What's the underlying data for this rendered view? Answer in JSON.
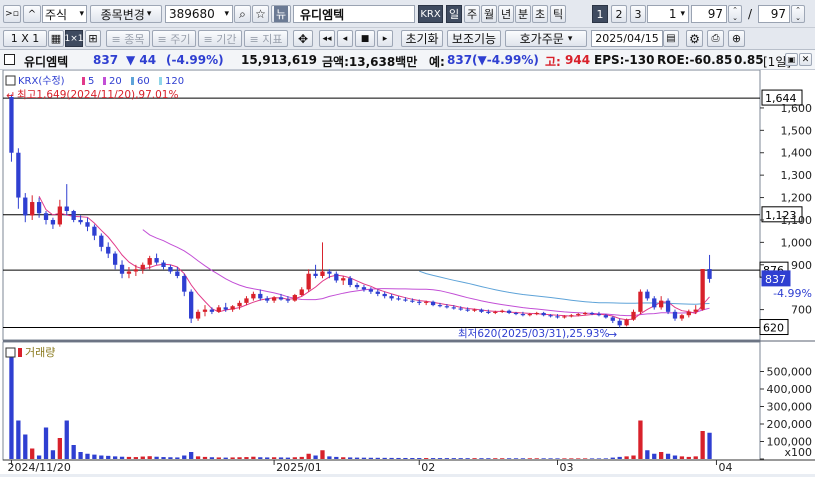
{
  "toolbar1": {
    "market": "주식",
    "change_btn": "종목변경",
    "code": "389680",
    "stock_name": "유디엠텍",
    "exchange": "KRX",
    "periods": [
      "일",
      "주",
      "월",
      "년",
      "분",
      "초",
      "틱"
    ],
    "chart_counts": [
      "1",
      "2",
      "3"
    ],
    "count_value": "1",
    "page_value": "97",
    "slash": "/",
    "page_total": "97"
  },
  "toolbar2": {
    "grid_label": "1 X 1",
    "items_label": "≡ 종목",
    "cycle_label": "≡ 주기",
    "period_label": "≡ 기간",
    "indicator_label": "≡ 지표",
    "reset_label": "초기화",
    "aux_label": "보조기능",
    "order_label": "호가주문",
    "date": "2025/04/15"
  },
  "infobar": {
    "name": "유디엠텍",
    "price": "837",
    "change": "▼ 44",
    "rate": "(-4.99%)",
    "volume": "15,913,619",
    "amount": "금액:13,638백만",
    "expected_label": "예:",
    "expected_value": "837(▼-4.99%)",
    "high_label": "고:",
    "high_value": "944",
    "eps": "EPS:-130",
    "roe": "ROE:-60.85",
    "ratio": "0.85",
    "unit": "[1일]"
  },
  "legend": {
    "price_title": "KRX(수정)",
    "ma": [
      "5",
      "20",
      "60",
      "120"
    ],
    "ma_colors": [
      "#e13a8a",
      "#c24fd6",
      "#5ea3d8",
      "#8fd5e8"
    ],
    "max_note": "최고1,649(2024/11/20),97.01%",
    "min_note": "최저620(2025/03/31),25.93%",
    "volume_title": "거래량"
  },
  "colors": {
    "up": "#d8212b",
    "down": "#2f3fd1",
    "ma5": "#e13a8a",
    "ma20": "#c24fd6",
    "ma60": "#5ea3d8",
    "ma120": "#8fd5e8"
  },
  "chart_data": {
    "type": "candlestick",
    "ylim": [
      600,
      1680
    ],
    "y_ticks": [
      "1,600",
      "1,500",
      "1,400",
      "1,300",
      "1,200",
      "1,100",
      "1,000",
      "900",
      "700"
    ],
    "markers": [
      {
        "label": "1,644",
        "value": 1644,
        "color": "#000000"
      },
      {
        "label": "1,123",
        "value": 1123,
        "color": "#000000"
      },
      {
        "label": "876",
        "value": 876,
        "color": "#000000"
      },
      {
        "label": "837",
        "value": 837,
        "color": "#2f3fd1"
      },
      {
        "label": "620",
        "value": 620,
        "color": "#000000"
      }
    ],
    "current_change": "-4.99%",
    "x_labels": [
      "2024/11/20",
      "2025/01",
      "02",
      "03",
      "04"
    ],
    "x_label_index": [
      0,
      38,
      59,
      79,
      102
    ],
    "volume_ticks": [
      "500,000",
      "400,000",
      "300,000",
      "200,000",
      "100,000",
      "x100"
    ],
    "volume_max": 6000000,
    "candles": [
      [
        1649,
        1660,
        1360,
        1400
      ],
      [
        1400,
        1420,
        1150,
        1200
      ],
      [
        1200,
        1220,
        1090,
        1120
      ],
      [
        1120,
        1210,
        1100,
        1180
      ],
      [
        1180,
        1200,
        1110,
        1130
      ],
      [
        1130,
        1140,
        1080,
        1100
      ],
      [
        1100,
        1110,
        1060,
        1080
      ],
      [
        1080,
        1190,
        1070,
        1160
      ],
      [
        1160,
        1260,
        1120,
        1140
      ],
      [
        1140,
        1145,
        1090,
        1100
      ],
      [
        1100,
        1120,
        1080,
        1090
      ],
      [
        1090,
        1110,
        1050,
        1070
      ],
      [
        1070,
        1080,
        1010,
        1030
      ],
      [
        1030,
        1040,
        960,
        980
      ],
      [
        980,
        1000,
        930,
        950
      ],
      [
        950,
        960,
        880,
        900
      ],
      [
        900,
        920,
        840,
        860
      ],
      [
        860,
        890,
        840,
        870
      ],
      [
        870,
        900,
        850,
        880
      ],
      [
        880,
        910,
        860,
        900
      ],
      [
        900,
        940,
        880,
        930
      ],
      [
        930,
        950,
        900,
        910
      ],
      [
        910,
        920,
        880,
        890
      ],
      [
        890,
        900,
        860,
        870
      ],
      [
        870,
        890,
        840,
        850
      ],
      [
        850,
        860,
        760,
        780
      ],
      [
        780,
        790,
        640,
        660
      ],
      [
        660,
        700,
        650,
        690
      ],
      [
        690,
        720,
        670,
        700
      ],
      [
        700,
        710,
        680,
        690
      ],
      [
        690,
        720,
        685,
        710
      ],
      [
        710,
        730,
        690,
        700
      ],
      [
        700,
        720,
        690,
        715
      ],
      [
        715,
        740,
        700,
        730
      ],
      [
        730,
        760,
        720,
        750
      ],
      [
        750,
        780,
        740,
        770
      ],
      [
        770,
        790,
        740,
        750
      ],
      [
        750,
        760,
        730,
        740
      ],
      [
        740,
        760,
        730,
        755
      ],
      [
        755,
        770,
        740,
        745
      ],
      [
        745,
        760,
        730,
        740
      ],
      [
        740,
        770,
        735,
        765
      ],
      [
        765,
        800,
        760,
        790
      ],
      [
        790,
        880,
        780,
        860
      ],
      [
        860,
        900,
        840,
        850
      ],
      [
        850,
        1000,
        840,
        870
      ],
      [
        870,
        880,
        840,
        860
      ],
      [
        860,
        870,
        820,
        830
      ],
      [
        830,
        850,
        810,
        840
      ],
      [
        840,
        850,
        800,
        810
      ],
      [
        810,
        820,
        790,
        800
      ],
      [
        800,
        810,
        780,
        790
      ],
      [
        790,
        800,
        770,
        780
      ],
      [
        780,
        790,
        760,
        770
      ],
      [
        770,
        780,
        750,
        760
      ],
      [
        760,
        770,
        740,
        750
      ],
      [
        750,
        760,
        740,
        745
      ],
      [
        745,
        755,
        735,
        740
      ],
      [
        740,
        750,
        730,
        735
      ],
      [
        735,
        745,
        720,
        730
      ],
      [
        730,
        740,
        720,
        735
      ],
      [
        735,
        740,
        715,
        720
      ],
      [
        720,
        730,
        710,
        715
      ],
      [
        715,
        725,
        705,
        710
      ],
      [
        710,
        720,
        700,
        705
      ],
      [
        705,
        715,
        695,
        700
      ],
      [
        700,
        710,
        690,
        695
      ],
      [
        695,
        705,
        690,
        700
      ],
      [
        700,
        705,
        685,
        690
      ],
      [
        690,
        700,
        680,
        685
      ],
      [
        685,
        695,
        680,
        690
      ],
      [
        690,
        700,
        685,
        695
      ],
      [
        695,
        700,
        680,
        685
      ],
      [
        685,
        690,
        675,
        680
      ],
      [
        680,
        690,
        670,
        675
      ],
      [
        675,
        685,
        670,
        680
      ],
      [
        680,
        690,
        675,
        685
      ],
      [
        685,
        690,
        670,
        675
      ],
      [
        675,
        680,
        665,
        670
      ],
      [
        670,
        680,
        660,
        665
      ],
      [
        665,
        675,
        660,
        670
      ],
      [
        670,
        680,
        665,
        675
      ],
      [
        675,
        685,
        670,
        680
      ],
      [
        680,
        690,
        675,
        685
      ],
      [
        685,
        690,
        675,
        680
      ],
      [
        680,
        690,
        670,
        675
      ],
      [
        675,
        680,
        660,
        665
      ],
      [
        665,
        670,
        640,
        650
      ],
      [
        650,
        660,
        620,
        630
      ],
      [
        630,
        660,
        625,
        655
      ],
      [
        655,
        700,
        650,
        690
      ],
      [
        690,
        790,
        680,
        780
      ],
      [
        780,
        790,
        740,
        750
      ],
      [
        750,
        760,
        700,
        710
      ],
      [
        710,
        760,
        700,
        740
      ],
      [
        740,
        750,
        680,
        690
      ],
      [
        690,
        700,
        650,
        660
      ],
      [
        660,
        680,
        650,
        675
      ],
      [
        675,
        700,
        665,
        690
      ],
      [
        690,
        720,
        680,
        700
      ],
      [
        700,
        880,
        695,
        881
      ],
      [
        881,
        944,
        820,
        837
      ]
    ],
    "volumes": [
      5800000,
      2200000,
      1400000,
      600000,
      200000,
      1800000,
      500000,
      1200000,
      2200000,
      800000,
      400000,
      300000,
      250000,
      200000,
      180000,
      150000,
      130000,
      120000,
      110000,
      140000,
      160000,
      130000,
      110000,
      100000,
      90000,
      200000,
      400000,
      150000,
      120000,
      100000,
      90000,
      80000,
      90000,
      100000,
      110000,
      130000,
      100000,
      90000,
      100000,
      90000,
      80000,
      100000,
      120000,
      300000,
      200000,
      500000,
      150000,
      120000,
      100000,
      90000,
      80000,
      75000,
      70000,
      68000,
      65000,
      62000,
      60000,
      58000,
      56000,
      55000,
      54000,
      53000,
      52000,
      51000,
      50000,
      49000,
      48000,
      47000,
      46000,
      45000,
      44000,
      43000,
      42000,
      41000,
      40000,
      40000,
      40000,
      39000,
      38000,
      37000,
      36000,
      36000,
      35000,
      35000,
      34000,
      34000,
      36000,
      80000,
      120000,
      150000,
      200000,
      2200000,
      500000,
      300000,
      400000,
      300000,
      200000,
      150000,
      120000,
      150000,
      1600000,
      1500000
    ]
  }
}
